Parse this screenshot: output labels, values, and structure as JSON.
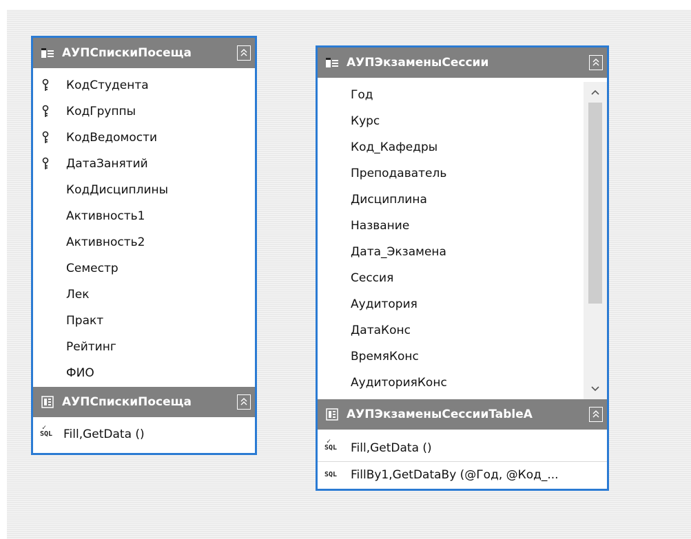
{
  "tables": [
    {
      "title": "АУПСпискиПосеща",
      "fields": [
        {
          "name": "КодСтудента",
          "key": true
        },
        {
          "name": "КодГруппы",
          "key": true
        },
        {
          "name": "КодВедомости",
          "key": true
        },
        {
          "name": "ДатаЗанятий",
          "key": true
        },
        {
          "name": "КодДисциплины",
          "key": false
        },
        {
          "name": "Активность1",
          "key": false
        },
        {
          "name": "Активность2",
          "key": false
        },
        {
          "name": "Семестр",
          "key": false
        },
        {
          "name": "Лек",
          "key": false
        },
        {
          "name": "Практ",
          "key": false
        },
        {
          "name": "Рейтинг",
          "key": false
        },
        {
          "name": "ФИО",
          "key": false
        }
      ],
      "adapter": {
        "title": "АУПСпискиПосеща",
        "methods": [
          {
            "label": "Fill,GetData ()",
            "icon": "sql-check-icon"
          }
        ]
      }
    },
    {
      "title": "АУПЭкзаменыСессии",
      "fields": [
        {
          "name": "Год",
          "key": false
        },
        {
          "name": "Курс",
          "key": false
        },
        {
          "name": "Код_Кафедры",
          "key": false
        },
        {
          "name": "Преподаватель",
          "key": false
        },
        {
          "name": "Дисциплина",
          "key": false
        },
        {
          "name": "Название",
          "key": false
        },
        {
          "name": "Дата_Экзамена",
          "key": false
        },
        {
          "name": "Сессия",
          "key": false
        },
        {
          "name": "Аудитория",
          "key": false
        },
        {
          "name": "ДатаКонс",
          "key": false
        },
        {
          "name": "ВремяКонс",
          "key": false
        },
        {
          "name": "АудиторияКонс",
          "key": false
        }
      ],
      "adapter": {
        "title": "АУПЭкзаменыСессииTableA",
        "methods": [
          {
            "label": "Fill,GetData ()",
            "icon": "sql-check-icon"
          },
          {
            "label": "FillBy1,GetDataBy (@Год, @Код_...",
            "icon": "sql-icon"
          }
        ]
      }
    }
  ],
  "icons": {
    "table_header": "datatable-icon",
    "adapter_header": "tableadapter-icon",
    "key": "primary-key-icon",
    "collapse": "collapse-chevron-icon",
    "scroll_up": "chevron-up-icon",
    "scroll_down": "chevron-down-icon"
  },
  "colors": {
    "selection_border": "#2b7bd3",
    "header_bg": "#808080",
    "header_text": "#ffffff"
  },
  "glyphs": {
    "collapse": "⌃⌃",
    "scroll_up": "^",
    "scroll_down": "⌄",
    "sql": "SQL",
    "check": "✓"
  }
}
